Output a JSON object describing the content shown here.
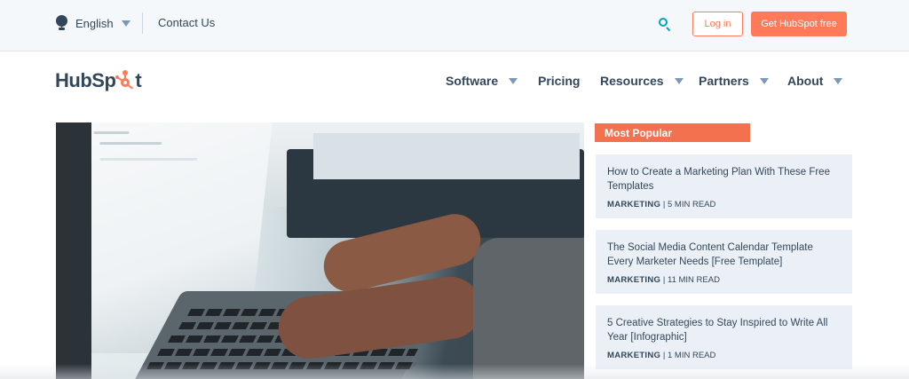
{
  "utility": {
    "language_label": "English",
    "contact_label": "Contact Us",
    "login_label": "Log in",
    "cta_label": "Get HubSpot free"
  },
  "logo": {
    "text_before": "HubSp",
    "text_after": "t"
  },
  "nav": {
    "items": [
      {
        "label": "Software",
        "has_dropdown": true
      },
      {
        "label": "Pricing",
        "has_dropdown": false
      },
      {
        "label": "Resources",
        "has_dropdown": true
      },
      {
        "label": "Partners",
        "has_dropdown": true
      },
      {
        "label": "About",
        "has_dropdown": true
      }
    ]
  },
  "sidebar": {
    "heading": "Most Popular",
    "cards": [
      {
        "title": "How to Create a Marketing Plan With These Free Templates",
        "tag": "MARKETING",
        "read_time": "5 MIN READ"
      },
      {
        "title": "The Social Media Content Calendar Template Every Marketer Needs [Free Template]",
        "tag": "MARKETING",
        "read_time": "11 MIN READ"
      },
      {
        "title": "5 Creative Strategies to Stay Inspired to Write All Year [Infographic]",
        "tag": "MARKETING",
        "read_time": "1 MIN READ"
      }
    ]
  },
  "colors": {
    "brand_orange": "#ff7a59",
    "accent_teal": "#00a4bd",
    "text_dark": "#33475b",
    "card_bg": "#eaf0f6"
  },
  "icons": {
    "language": "globe-icon",
    "search": "search-icon",
    "dropdown": "chevron-down-icon",
    "logo_mark": "sprocket-icon"
  }
}
